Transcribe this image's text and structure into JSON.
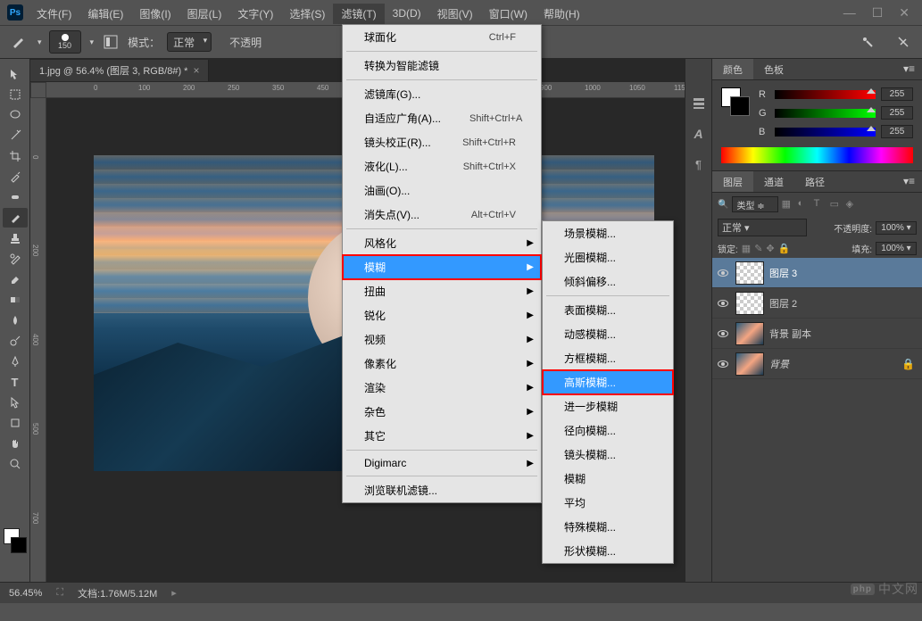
{
  "app": {
    "logo": "Ps"
  },
  "window_controls": {
    "min": "—",
    "max": "☐",
    "close": "✕"
  },
  "menu": {
    "items": [
      {
        "label": "文件(F)"
      },
      {
        "label": "编辑(E)"
      },
      {
        "label": "图像(I)"
      },
      {
        "label": "图层(L)"
      },
      {
        "label": "文字(Y)"
      },
      {
        "label": "选择(S)"
      },
      {
        "label": "滤镜(T)",
        "active": true
      },
      {
        "label": "3D(D)"
      },
      {
        "label": "视图(V)"
      },
      {
        "label": "窗口(W)"
      },
      {
        "label": "帮助(H)"
      }
    ]
  },
  "options": {
    "brush_size": "150",
    "mode_label": "模式：",
    "mode_value": "正常",
    "opacity_label": "不透明"
  },
  "document": {
    "tab_title": "1.jpg @ 56.4% (图层 3, RGB/8#) *"
  },
  "filter_menu": {
    "items": [
      {
        "type": "item",
        "label": "球面化",
        "shortcut": "Ctrl+F"
      },
      {
        "type": "sep"
      },
      {
        "type": "item",
        "label": "转换为智能滤镜"
      },
      {
        "type": "sep"
      },
      {
        "type": "item",
        "label": "滤镜库(G)..."
      },
      {
        "type": "item",
        "label": "自适应广角(A)...",
        "shortcut": "Shift+Ctrl+A"
      },
      {
        "type": "item",
        "label": "镜头校正(R)...",
        "shortcut": "Shift+Ctrl+R"
      },
      {
        "type": "item",
        "label": "液化(L)...",
        "shortcut": "Shift+Ctrl+X"
      },
      {
        "type": "item",
        "label": "油画(O)..."
      },
      {
        "type": "item",
        "label": "消失点(V)...",
        "shortcut": "Alt+Ctrl+V"
      },
      {
        "type": "sep"
      },
      {
        "type": "item",
        "label": "风格化",
        "sub": true
      },
      {
        "type": "item",
        "label": "模糊",
        "sub": true,
        "highlighted": true,
        "framed": true
      },
      {
        "type": "item",
        "label": "扭曲",
        "sub": true
      },
      {
        "type": "item",
        "label": "锐化",
        "sub": true
      },
      {
        "type": "item",
        "label": "视频",
        "sub": true
      },
      {
        "type": "item",
        "label": "像素化",
        "sub": true
      },
      {
        "type": "item",
        "label": "渲染",
        "sub": true
      },
      {
        "type": "item",
        "label": "杂色",
        "sub": true
      },
      {
        "type": "item",
        "label": "其它",
        "sub": true
      },
      {
        "type": "sep"
      },
      {
        "type": "item",
        "label": "Digimarc",
        "sub": true
      },
      {
        "type": "sep"
      },
      {
        "type": "item",
        "label": "浏览联机滤镜..."
      }
    ]
  },
  "blur_submenu": {
    "items": [
      {
        "label": "场景模糊..."
      },
      {
        "label": "光圈模糊..."
      },
      {
        "label": "倾斜偏移..."
      },
      {
        "sep": true
      },
      {
        "label": "表面模糊..."
      },
      {
        "label": "动感模糊..."
      },
      {
        "label": "方框模糊..."
      },
      {
        "label": "高斯模糊...",
        "highlighted": true,
        "framed": true
      },
      {
        "label": "进一步模糊"
      },
      {
        "label": "径向模糊..."
      },
      {
        "label": "镜头模糊..."
      },
      {
        "label": "模糊"
      },
      {
        "label": "平均"
      },
      {
        "label": "特殊模糊..."
      },
      {
        "label": "形状模糊..."
      }
    ]
  },
  "color_panel": {
    "tabs": [
      "颜色",
      "色板"
    ],
    "channels": [
      {
        "label": "R",
        "value": "255"
      },
      {
        "label": "G",
        "value": "255"
      },
      {
        "label": "B",
        "value": "255"
      }
    ]
  },
  "layers_panel": {
    "tabs": [
      "图层",
      "通道",
      "路径"
    ],
    "filter_label": "类型",
    "blend_mode": "正常",
    "opacity_label": "不透明度:",
    "opacity_value": "100%",
    "lock_label": "锁定:",
    "fill_label": "填充:",
    "fill_value": "100%",
    "layers": [
      {
        "name": "图层 3",
        "selected": true,
        "type": "trans"
      },
      {
        "name": "图层 2",
        "type": "trans"
      },
      {
        "name": "背景 副本",
        "type": "img"
      },
      {
        "name": "背景",
        "type": "img",
        "locked": true,
        "italic": true
      }
    ]
  },
  "status": {
    "zoom": "56.45%",
    "doc_info_label": "文档:",
    "doc_info": "1.76M/5.12M"
  },
  "watermark": {
    "logo": "php",
    "text": "中文网"
  },
  "icons": {
    "search": "🔍",
    "brush": "✎",
    "eye": "👁"
  }
}
